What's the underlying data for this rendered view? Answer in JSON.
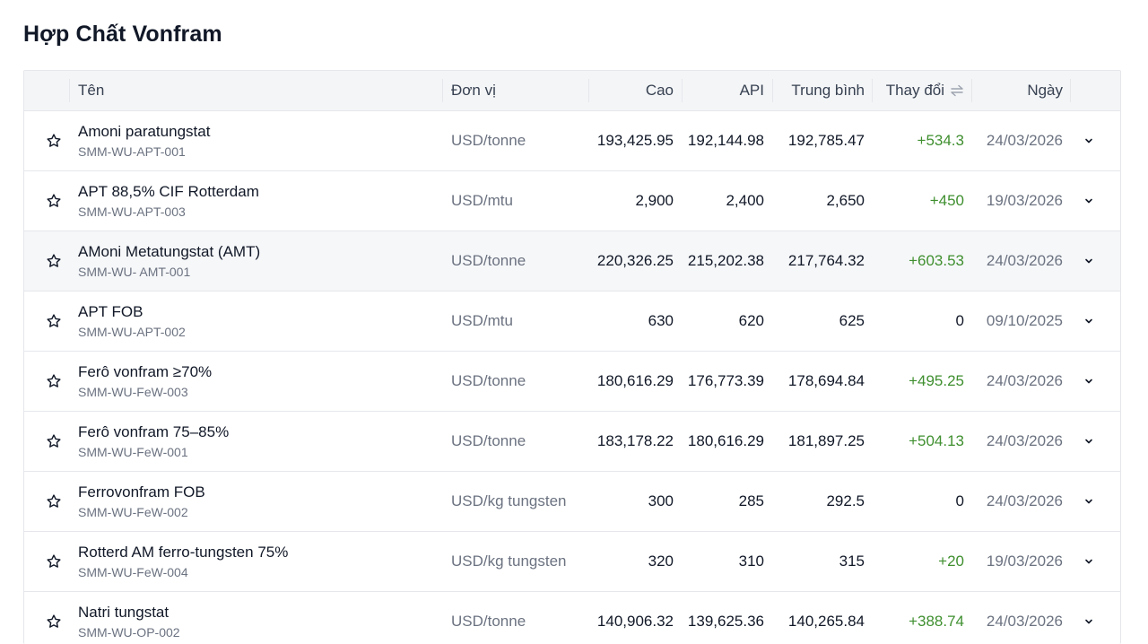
{
  "page": {
    "title": "Hợp Chất Vonfram"
  },
  "table": {
    "headers": {
      "name": "Tên",
      "unit": "Đơn vị",
      "high": "Cao",
      "low": "API",
      "avg": "Trung bình",
      "change": "Thay đổi",
      "date": "Ngày"
    },
    "rows": [
      {
        "name": "Amoni paratungstat",
        "code": "SMM-WU-APT-001",
        "unit": "USD/tonne",
        "high": "193,425.95",
        "low": "192,144.98",
        "avg": "192,785.47",
        "change": "+534.3",
        "date": "24/03/2026"
      },
      {
        "name": "APT 88,5% CIF Rotterdam",
        "code": "SMM-WU-APT-003",
        "unit": "USD/mtu",
        "high": "2,900",
        "low": "2,400",
        "avg": "2,650",
        "change": "+450",
        "date": "19/03/2026"
      },
      {
        "name": "AMoni Metatungstat (AMT)",
        "code": "SMM-WU- AMT-001",
        "unit": "USD/tonne",
        "high": "220,326.25",
        "low": "215,202.38",
        "avg": "217,764.32",
        "change": "+603.53",
        "date": "24/03/2026"
      },
      {
        "name": "APT FOB",
        "code": "SMM-WU-APT-002",
        "unit": "USD/mtu",
        "high": "630",
        "low": "620",
        "avg": "625",
        "change": "0",
        "date": "09/10/2025"
      },
      {
        "name": "Ferô vonfram ≥70%",
        "code": "SMM-WU-FeW-003",
        "unit": "USD/tonne",
        "high": "180,616.29",
        "low": "176,773.39",
        "avg": "178,694.84",
        "change": "+495.25",
        "date": "24/03/2026"
      },
      {
        "name": "Ferô vonfram 75–85%",
        "code": "SMM-WU-FeW-001",
        "unit": "USD/tonne",
        "high": "183,178.22",
        "low": "180,616.29",
        "avg": "181,897.25",
        "change": "+504.13",
        "date": "24/03/2026"
      },
      {
        "name": "Ferrovonfram FOB",
        "code": "SMM-WU-FeW-002",
        "unit": "USD/kg tungsten",
        "high": "300",
        "low": "285",
        "avg": "292.5",
        "change": "0",
        "date": "24/03/2026"
      },
      {
        "name": "Rotterd AM ferro-tungsten 75%",
        "code": "SMM-WU-FeW-004",
        "unit": "USD/kg tungsten",
        "high": "320",
        "low": "310",
        "avg": "315",
        "change": "+20",
        "date": "19/03/2026"
      },
      {
        "name": "Natri tungstat",
        "code": "SMM-WU-OP-002",
        "unit": "USD/tonne",
        "high": "140,906.32",
        "low": "139,625.36",
        "avg": "140,265.84",
        "change": "+388.74",
        "date": "24/03/2026"
      }
    ]
  },
  "icons": {
    "favorite": "star-outline-icon",
    "expand": "chevron-down-icon",
    "sort": "sort-arrows-icon"
  },
  "colors": {
    "positive": "#3f8f2f",
    "header_bg": "#f4f5f7",
    "hover_bg": "#f6f7f9",
    "border": "#e5e7eb"
  }
}
